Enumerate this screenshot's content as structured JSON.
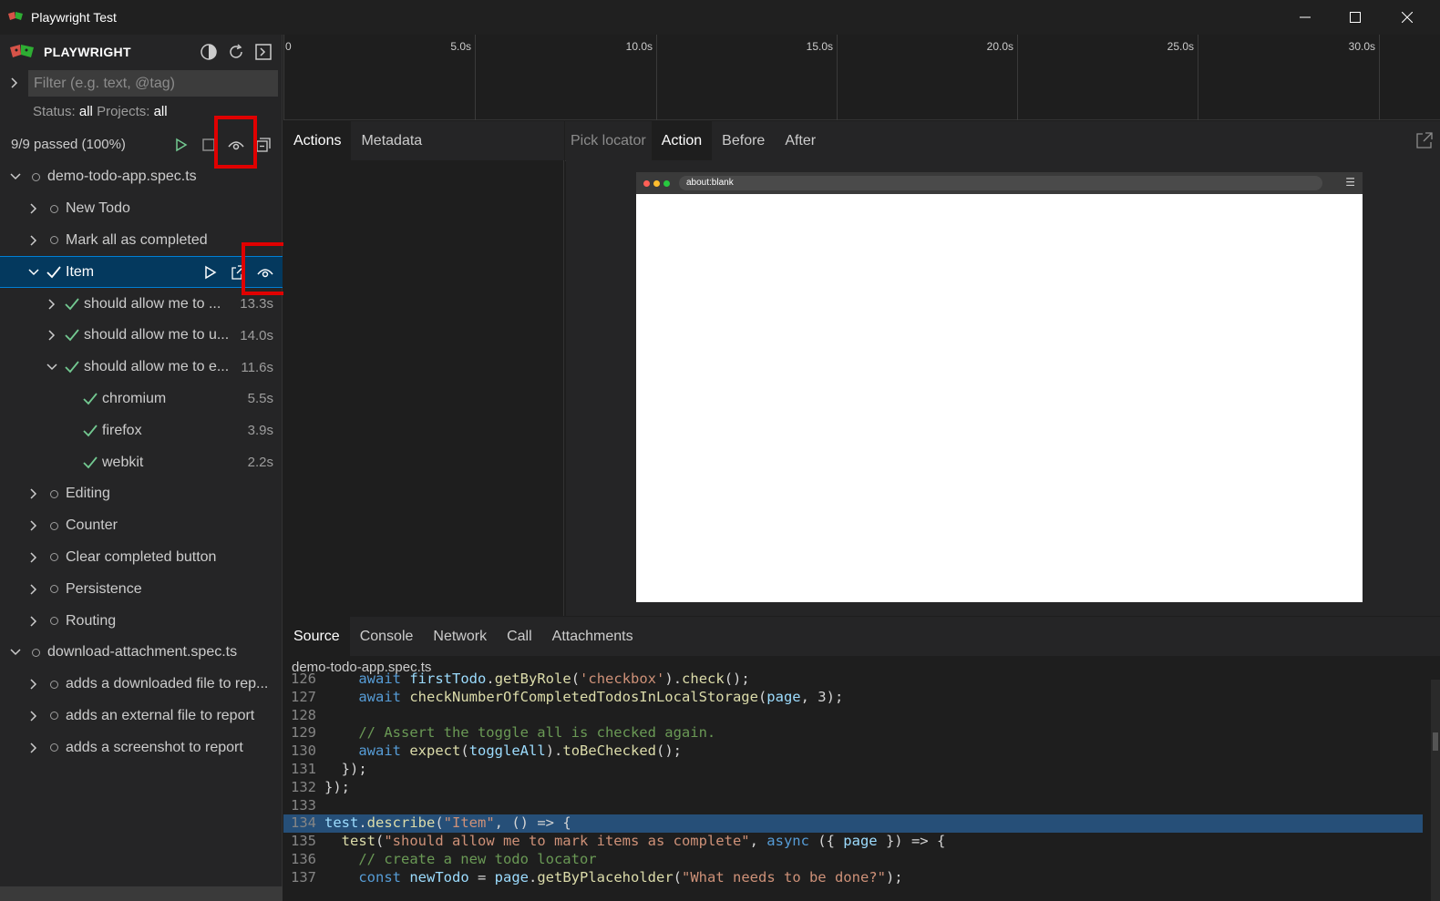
{
  "window": {
    "title": "Playwright Test"
  },
  "sidebar": {
    "brand": "PLAYWRIGHT",
    "filter_placeholder": "Filter (e.g. text, @tag)",
    "status_label": "Status:",
    "status_value": "all",
    "projects_label": "Projects:",
    "projects_value": "all",
    "summary": "9/9 passed (100%)",
    "tree": [
      {
        "label": "demo-todo-app.spec.ts",
        "level": 0,
        "expanded": true,
        "state": "idle"
      },
      {
        "label": "New Todo",
        "level": 1,
        "expanded": false,
        "state": "idle"
      },
      {
        "label": "Mark all as completed",
        "level": 1,
        "expanded": false,
        "state": "idle"
      },
      {
        "label": "Item",
        "level": 1,
        "expanded": true,
        "state": "passed",
        "selected": true
      },
      {
        "label": "should allow me to ...",
        "level": 2,
        "expanded": false,
        "state": "passed",
        "time": "13.3s"
      },
      {
        "label": "should allow me to u...",
        "level": 2,
        "expanded": false,
        "state": "passed",
        "time": "14.0s"
      },
      {
        "label": "should allow me to e...",
        "level": 2,
        "expanded": true,
        "state": "passed",
        "time": "11.6s"
      },
      {
        "label": "chromium",
        "level": 3,
        "state": "passed",
        "time": "5.5s"
      },
      {
        "label": "firefox",
        "level": 3,
        "state": "passed",
        "time": "3.9s"
      },
      {
        "label": "webkit",
        "level": 3,
        "state": "passed",
        "time": "2.2s"
      },
      {
        "label": "Editing",
        "level": 1,
        "expanded": false,
        "state": "idle"
      },
      {
        "label": "Counter",
        "level": 1,
        "expanded": false,
        "state": "idle"
      },
      {
        "label": "Clear completed button",
        "level": 1,
        "expanded": false,
        "state": "idle"
      },
      {
        "label": "Persistence",
        "level": 1,
        "expanded": false,
        "state": "idle"
      },
      {
        "label": "Routing",
        "level": 1,
        "expanded": false,
        "state": "idle"
      },
      {
        "label": "download-attachment.spec.ts",
        "level": 0,
        "expanded": true,
        "state": "idle"
      },
      {
        "label": "adds a downloaded file to rep...",
        "level": 1,
        "expanded": false,
        "state": "idle"
      },
      {
        "label": "adds an external file to report",
        "level": 1,
        "expanded": false,
        "state": "idle"
      },
      {
        "label": "adds a screenshot to report",
        "level": 1,
        "expanded": false,
        "state": "idle"
      }
    ]
  },
  "timeline": {
    "ticks": [
      "0",
      "5.0s",
      "10.0s",
      "15.0s",
      "20.0s",
      "25.0s",
      "30.0s"
    ]
  },
  "actions_tabs": [
    "Actions",
    "Metadata"
  ],
  "preview_tabs": {
    "pick_locator": "Pick locator",
    "tabs": [
      "Action",
      "Before",
      "After"
    ]
  },
  "browser": {
    "url": "about:blank"
  },
  "bottom_tabs": [
    "Source",
    "Console",
    "Network",
    "Call",
    "Attachments"
  ],
  "source": {
    "filename": "demo-todo-app.spec.ts",
    "lines": [
      {
        "n": "126",
        "text": "    await firstTodo.getByRole('checkbox').check();"
      },
      {
        "n": "127",
        "text": "    await checkNumberOfCompletedTodosInLocalStorage(page, 3);"
      },
      {
        "n": "128",
        "text": ""
      },
      {
        "n": "129",
        "text": "    // Assert the toggle all is checked again."
      },
      {
        "n": "130",
        "text": "    await expect(toggleAll).toBeChecked();"
      },
      {
        "n": "131",
        "text": "  });"
      },
      {
        "n": "132",
        "text": "});"
      },
      {
        "n": "133",
        "text": ""
      },
      {
        "n": "134",
        "text": "test.describe(\"Item\", () => {"
      },
      {
        "n": "135",
        "text": "  test(\"should allow me to mark items as complete\", async ({ page }) => {"
      },
      {
        "n": "136",
        "text": "    // create a new todo locator"
      },
      {
        "n": "137",
        "text": "    const newTodo = page.getByPlaceholder(\"What needs to be done?\");"
      }
    ]
  },
  "colors": {
    "accent": "#007fd4",
    "pass": "#73c991",
    "highlight": "#e00000"
  }
}
